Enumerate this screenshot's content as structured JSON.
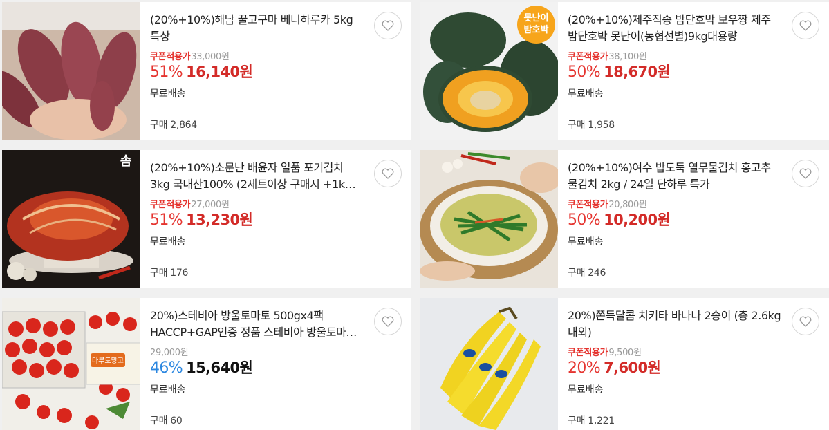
{
  "products": [
    {
      "title": "(20%+10%)해남 꿀고구마 베니하루카 5kg 특상",
      "coupon_label": "쿠폰적용가",
      "original_price": "33,000",
      "original_unit": "원",
      "discount": "51%",
      "price": "16,140원",
      "shipping": "무료배송",
      "bought": "구매 2,864",
      "image": "sweet-potato"
    },
    {
      "title": "(20%+10%)제주직송 밤단호박 보우짱 제주 밤단호박 못난이(농협선별)9kg대용량",
      "coupon_label": "쿠폰적용가",
      "original_price": "38,100",
      "original_unit": "원",
      "discount": "50%",
      "price": "18,670원",
      "shipping": "무료배송",
      "bought": "구매 1,958",
      "image": "pumpkin",
      "badge": [
        "못난이",
        "밤호박"
      ]
    },
    {
      "title": "(20%+10%)소문난 배윤자 일품 포기김치 3kg 국내산100% (2세트이상 구매시 +1k…",
      "coupon_label": "쿠폰적용가",
      "original_price": "27,000",
      "original_unit": "원",
      "discount": "51%",
      "price": "13,230원",
      "shipping": "무료배송",
      "bought": "구매 176",
      "image": "kimchi",
      "logo": "솜"
    },
    {
      "title": "(20%+10%)여수 밥도둑 열무물김치 홍고추 물김치 2kg / 24일 단하루 특가",
      "coupon_label": "쿠폰적용가",
      "original_price": "20,800",
      "original_unit": "원",
      "discount": "50%",
      "price": "10,200원",
      "shipping": "무료배송",
      "bought": "구매 246",
      "image": "water-kimchi"
    },
    {
      "title": "20%)스테비아 방울토마토 500gx4팩 HACCP+GAP인증 정품 스테비아 방울토마…",
      "coupon_label": "",
      "original_price": "29,000",
      "original_unit": "원",
      "discount": "46%",
      "price": "15,640원",
      "shipping": "무료배송",
      "bought": "구매 60",
      "image": "tomato",
      "pack_label": "마루토망고"
    },
    {
      "title": "20%)쫀득달콤 치키타 바나나 2송이 (총 2.6kg내외)",
      "coupon_label": "쿠폰적용가",
      "original_price": "9,500",
      "original_unit": "원",
      "discount": "20%",
      "price": "7,600원",
      "shipping": "무료배송",
      "bought": "구매 1,221",
      "image": "banana"
    }
  ],
  "colors": {
    "discount_red": "#e5342f",
    "discount_blue": "#2a86e0",
    "price_red": "#d32b28",
    "price_black": "#111111"
  }
}
